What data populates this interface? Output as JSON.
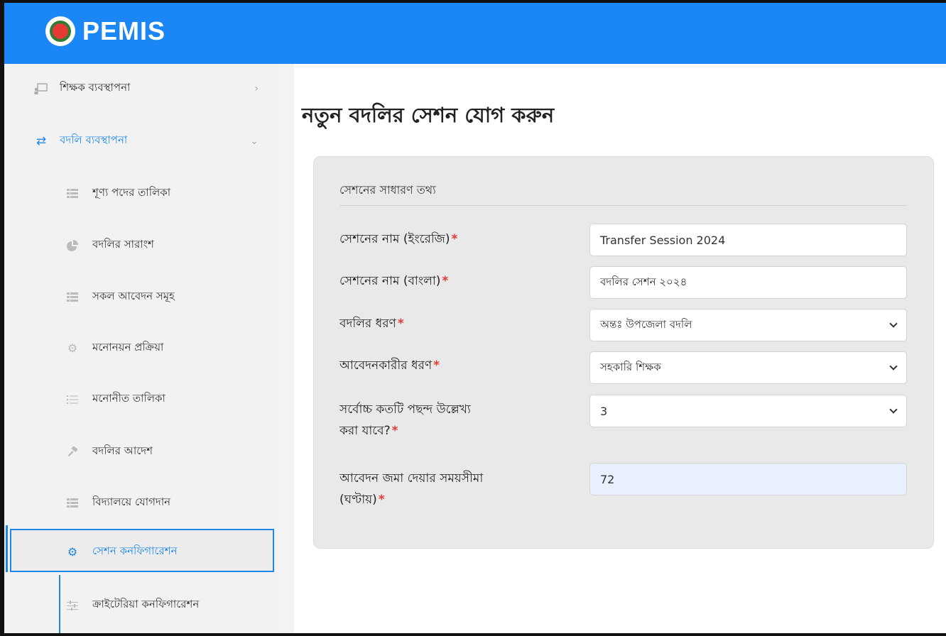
{
  "app": {
    "brand": "PEMIS"
  },
  "sidebar": {
    "items": [
      {
        "label": "শিক্ষক ব্যবস্থাপনা",
        "icon": "teacher-board-icon"
      },
      {
        "label": "বদলি ব্যবস্থাপনা",
        "icon": "transfer-arrows-icon"
      },
      {
        "label": "শূণ্য পদের তালিকা",
        "icon": "table-icon"
      },
      {
        "label": "বদলির সারাংশ",
        "icon": "pie-chart-icon"
      },
      {
        "label": "সকল আবেদন সমূহ",
        "icon": "table-icon"
      },
      {
        "label": "মনোনয়ন প্রক্রিয়া",
        "icon": "gear-icon"
      },
      {
        "label": "মনোনীত তালিকা",
        "icon": "list-icon"
      },
      {
        "label": "বদলির আদেশ",
        "icon": "gavel-icon"
      },
      {
        "label": "বিদ্যালয়ে যোগদান",
        "icon": "table-icon"
      },
      {
        "label": "সেশন কনফিগারেশন",
        "icon": "gear-icon"
      },
      {
        "label": "ক্রাইটেরিয়া কনফিগারেশন",
        "icon": "sliders-icon"
      }
    ]
  },
  "main": {
    "title": "নতুন বদলির সেশন যোগ করুন",
    "card_title": "সেশনের সাধারণ তথ্য",
    "fields": [
      {
        "label": "সেশনের নাম (ইংরেজি)",
        "value": "Transfer Session 2024"
      },
      {
        "label": "সেশনের নাম (বাংলা)",
        "value": "বদলির সেশন ২০২৪"
      },
      {
        "label": "বদলির ধরণ",
        "value": "অন্তঃ উপজেলা বদলি"
      },
      {
        "label": "আবেদনকারীর ধরণ",
        "value": "সহকারি শিক্ষক"
      },
      {
        "label_line1": "সর্বোচ্চ কতটি পছন্দ উল্লেখ্য",
        "label_line2": "করা যাবে?",
        "value": "3"
      },
      {
        "label_line1": "আবেদন জমা দেয়ার সময়সীমা",
        "label_line2": "(ঘণ্টায়)",
        "value": "72"
      }
    ],
    "required_mark": "*"
  },
  "colors": {
    "accent": "#1b86f5",
    "active_border": "#1e88e5",
    "required": "#e53935"
  }
}
